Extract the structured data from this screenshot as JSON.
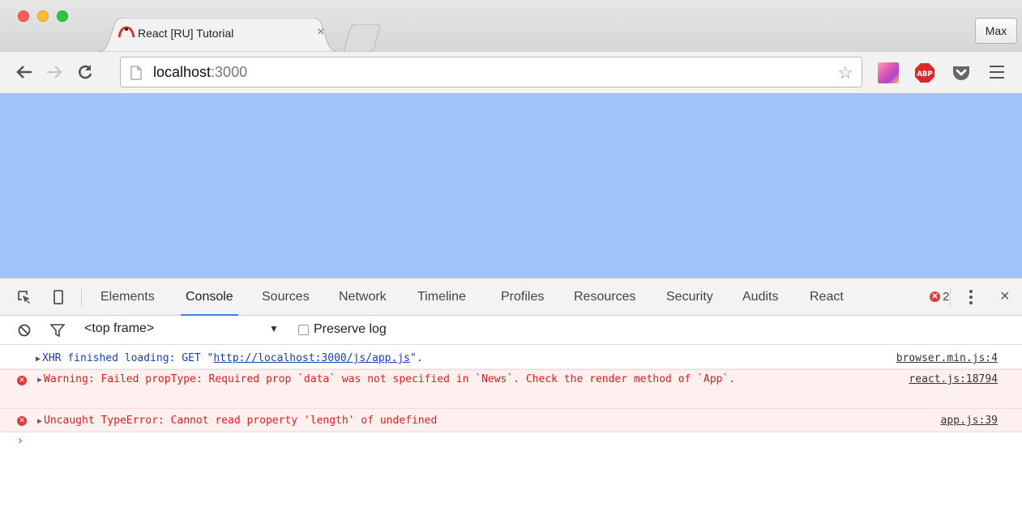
{
  "browser": {
    "tab": {
      "title": "React [RU] Tutorial",
      "close": "×"
    },
    "profile": "Max",
    "address": {
      "host": "localhost",
      "port": ":3000"
    }
  },
  "colors": {
    "viewport_bg": "#9ec4f9",
    "accent": "#3b82f3",
    "error": "#e21b1b"
  },
  "devtools": {
    "tabs": [
      "Elements",
      "Console",
      "Sources",
      "Network",
      "Timeline",
      "Profiles",
      "Resources",
      "Security",
      "Audits",
      "React"
    ],
    "active_tab": "Console",
    "error_count": "2",
    "close": "×",
    "filter": {
      "frame": "<top frame>",
      "preserve_log": "Preserve log"
    },
    "messages": {
      "xhr": {
        "prefix": "XHR finished loading: GET \"",
        "url": "http://localhost:3000/js/app.js",
        "suffix": "\".",
        "source": "browser.min.js:4"
      },
      "warning": {
        "text": "Warning: Failed propType: Required prop `data` was not specified in `News`. Check the render method of `App`.",
        "source": "react.js:18794"
      },
      "error": {
        "text": "Uncaught TypeError: Cannot read property 'length' of undefined",
        "source": "app.js:39"
      }
    },
    "prompt": "›"
  }
}
